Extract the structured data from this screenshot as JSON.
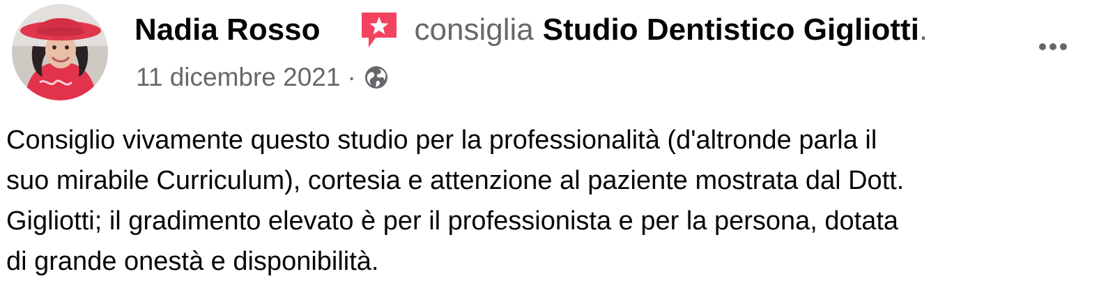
{
  "post": {
    "author": "Nadia Rosso",
    "action_icon": "recommendation-star-icon",
    "action_text": "consiglia",
    "page_name": "Studio Dentistico Gigliotti",
    "page_name_suffix": ".",
    "date": "11 dicembre 2021",
    "separator": "·",
    "privacy_icon": "globe-icon",
    "more_icon": "more-options-icon",
    "body_lines": [
      "Consiglio vivamente questo studio per la professionalità (d'altronde parla il",
      "suo mirabile Curriculum), cortesia e attenzione al paziente mostrata dal Dott.",
      "Gigliotti; il gradimento elevato è per il professionista e per la persona, dotata",
      "di grande onestà e disponibilità."
    ]
  },
  "colors": {
    "text_primary": "#050505",
    "text_secondary": "#65676b",
    "recommend_accent": "#f3425f"
  }
}
